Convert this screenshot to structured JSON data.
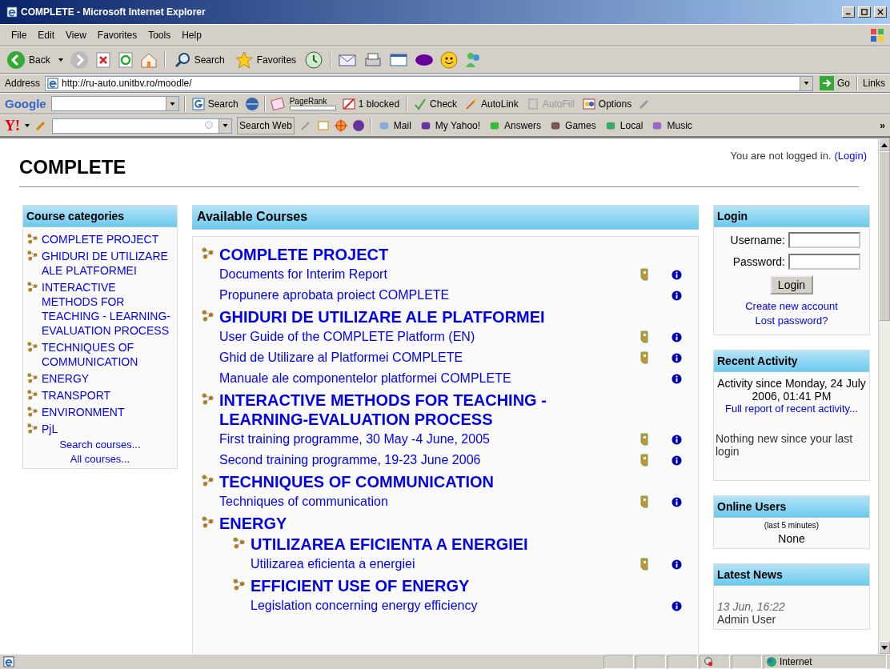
{
  "window": {
    "title": "COMPLETE - Microsoft Internet Explorer"
  },
  "menu": [
    "File",
    "Edit",
    "View",
    "Favorites",
    "Tools",
    "Help"
  ],
  "toolbar": {
    "back": "Back",
    "search": "Search",
    "favorites": "Favorites"
  },
  "address": {
    "label": "Address",
    "url": "http://ru-auto.unitbv.ro/moodle/",
    "go": "Go",
    "links": "Links"
  },
  "google_bar": {
    "logo": "Google",
    "search": "Search",
    "pagerank": "PageRank",
    "blocked": "1 blocked",
    "check": "Check",
    "autolink": "AutoLink",
    "autofill": "AutoFill",
    "autofill_disabled": true,
    "options": "Options"
  },
  "yahoo_bar": {
    "logo": "Y!",
    "search": "Search Web",
    "items": [
      "Mail",
      "My Yahoo!",
      "Answers",
      "Games",
      "Local",
      "Music"
    ],
    "more": "»"
  },
  "page": {
    "site_title": "COMPLETE",
    "login_info": "You are not logged in.",
    "login_link": "(Login)"
  },
  "course_categories": {
    "title": "Course categories",
    "items": [
      "COMPLETE PROJECT",
      "GHIDURI DE UTILIZARE ALE PLATFORMEI",
      "INTERACTIVE METHODS FOR TEACHING - LEARNING-EVALUATION PROCESS",
      "TECHNIQUES OF COMMUNICATION",
      "ENERGY",
      "TRANSPORT",
      "ENVIRONMENT",
      "PjL"
    ],
    "search": "Search courses...",
    "all": "All courses..."
  },
  "available_courses": {
    "title": "Available Courses",
    "categories": [
      {
        "name": "COMPLETE PROJECT",
        "courses": [
          {
            "name": "Documents for Interim Report",
            "guest": true
          },
          {
            "name": "Propunere aprobata proiect COMPLETE",
            "guest": false
          }
        ]
      },
      {
        "name": "GHIDURI DE UTILIZARE ALE PLATFORMEI",
        "courses": [
          {
            "name": "User Guide of the COMPLETE Platform (EN)",
            "guest": true
          },
          {
            "name": "Ghid de Utilizare al Platformei COMPLETE",
            "guest": true
          },
          {
            "name": "Manuale ale componentelor platformei COMPLETE",
            "guest": false
          }
        ]
      },
      {
        "name": "INTERACTIVE METHODS FOR TEACHING - LEARNING-EVALUATION PROCESS",
        "courses": [
          {
            "name": "First training programme, 30 May -4 June, 2005",
            "guest": true
          },
          {
            "name": "Second training programme, 19-23 June 2006",
            "guest": true
          }
        ]
      },
      {
        "name": "TECHNIQUES OF COMMUNICATION",
        "courses": [
          {
            "name": "Techniques of communication",
            "guest": true
          }
        ]
      },
      {
        "name": "ENERGY",
        "children": [
          {
            "name": "UTILIZAREA EFICIENTA A ENERGIEI",
            "courses": [
              {
                "name": "Utilizarea eficienta a energiei",
                "guest": true
              }
            ]
          },
          {
            "name": "EFFICIENT USE OF ENERGY",
            "courses": [
              {
                "name": "Legislation concerning energy efficiency",
                "guest": false
              }
            ]
          }
        ]
      }
    ]
  },
  "login_block": {
    "title": "Login",
    "username_label": "Username:",
    "password_label": "Password:",
    "button": "Login",
    "create": "Create new account",
    "lost": "Lost password?"
  },
  "recent_activity": {
    "title": "Recent Activity",
    "since": "Activity since Monday, 24 July 2006, 01:41 PM",
    "full_report": "Full report of recent activity...",
    "nothing": "Nothing new since your last login"
  },
  "online_users": {
    "title": "Online Users",
    "period": "(last 5 minutes)",
    "none": "None"
  },
  "latest_news": {
    "title": "Latest News",
    "date": "13 Jun, 16:22",
    "author": "Admin User"
  },
  "status_bar": {
    "zone": "Internet"
  }
}
